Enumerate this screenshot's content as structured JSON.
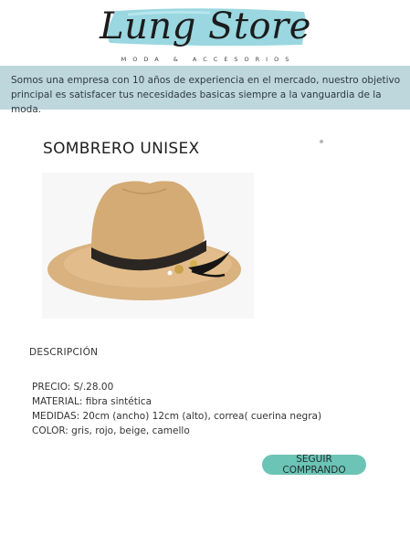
{
  "brand": {
    "name": "Lung Store",
    "tagline": "MODA & ACCESORIOS",
    "accent_color": "#8fd3dd"
  },
  "banner": {
    "text": "Somos una empresa con 10 años de experiencia en el mercado, nuestro objetivo principal es satisfacer tus necesidades basicas siempre a la vanguardia de la moda.",
    "background": "#bed7dc"
  },
  "product": {
    "title": "SOMBRERO UNISEX",
    "image_subject": "camel felt fedora hat with black leather band"
  },
  "description": {
    "heading": "DESCRIPCIÓN",
    "lines": [
      "PRECIO: S/.28.00",
      "MATERIAL: fibra sintética",
      "MEDIDAS: 20cm (ancho) 12cm (alto), correa( cuerina negra)",
      "COLOR: gris, rojo, beige, camello"
    ]
  },
  "actions": {
    "continue_label": "SEGUIR COMPRANDO",
    "button_color": "#6cc4b6"
  }
}
